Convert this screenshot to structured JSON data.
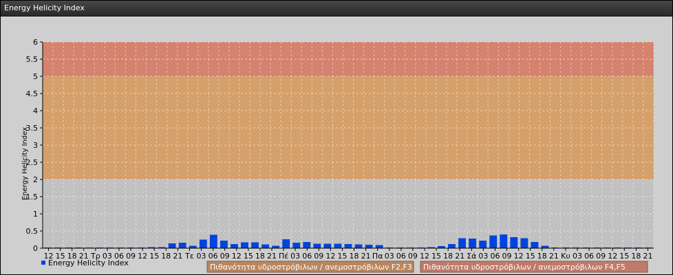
{
  "window": {
    "title": "Energy Helicity Index"
  },
  "chart_data": {
    "type": "bar",
    "title": "",
    "ylabel": "Energy Helicity Index",
    "xlabel": "",
    "ylim": [
      0,
      6
    ],
    "yticks": [
      "0",
      "0.5",
      "1",
      "1.5",
      "2",
      "2.5",
      "3",
      "3.5",
      "4",
      "4.5",
      "5",
      "5.5",
      "6"
    ],
    "grid": true,
    "categories": [
      "12",
      "15",
      "18",
      "21",
      "Τρ",
      "03",
      "06",
      "09",
      "12",
      "15",
      "18",
      "21",
      "Τε",
      "03",
      "06",
      "09",
      "12",
      "15",
      "18",
      "21",
      "Πέ",
      "03",
      "06",
      "09",
      "12",
      "15",
      "18",
      "21",
      "Πα",
      "03",
      "06",
      "09",
      "12",
      "15",
      "18",
      "21",
      "Σά",
      "03",
      "06",
      "09",
      "12",
      "15",
      "18",
      "21",
      "Κυ",
      "03",
      "06",
      "09",
      "12",
      "15",
      "18",
      "21"
    ],
    "series": [
      {
        "name": "Energy Helicity Index",
        "color": "#0044dd",
        "values": [
          0.02,
          0.02,
          0.02,
          0.02,
          0.02,
          0.02,
          0.02,
          0.02,
          0.02,
          0.02,
          0.03,
          0.03,
          0.14,
          0.16,
          0.07,
          0.25,
          0.39,
          0.22,
          0.12,
          0.17,
          0.17,
          0.11,
          0.07,
          0.26,
          0.16,
          0.18,
          0.13,
          0.13,
          0.13,
          0.12,
          0.11,
          0.1,
          0.09,
          0.02,
          0.02,
          0.02,
          0.02,
          0.03,
          0.06,
          0.12,
          0.29,
          0.28,
          0.22,
          0.37,
          0.4,
          0.32,
          0.29,
          0.18,
          0.07,
          0.02,
          0.02,
          0.02,
          0.02,
          0.02,
          0.02,
          0.02,
          0.02,
          0.02,
          0.02
        ]
      }
    ],
    "bands": [
      {
        "from": 0,
        "to": 2,
        "color": "#c4c4c4"
      },
      {
        "from": 2,
        "to": 5,
        "color": "#d8a26c",
        "label": "Πιθανότητα υδροστρόβιλων / ανεμοστρόβιλων F2,F3"
      },
      {
        "from": 5,
        "to": 6,
        "color": "#d88470",
        "label": "Πιθανότητα υδροστρόβιλων / ανεμοστρόβιλων F4,F5"
      }
    ],
    "legend": {
      "position": "bottom-left"
    }
  }
}
